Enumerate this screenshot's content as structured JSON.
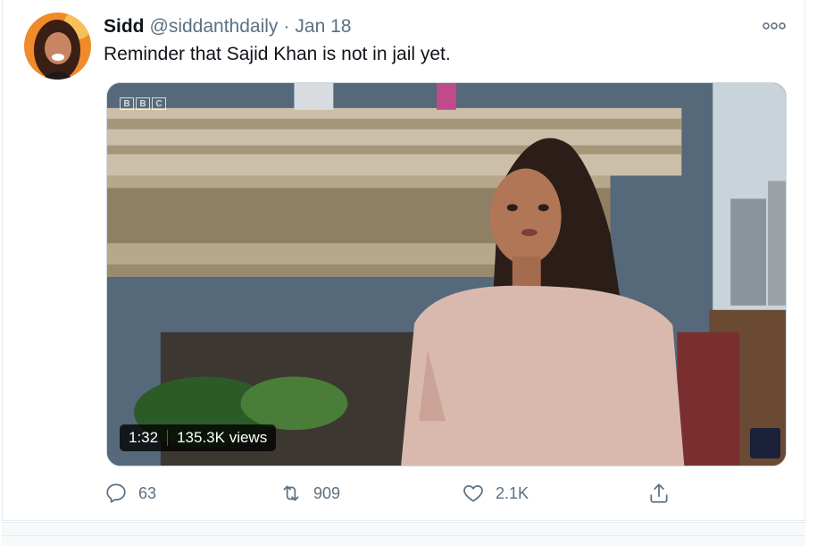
{
  "tweet": {
    "display_name": "Sidd",
    "handle": "@siddanthdaily",
    "separator": "·",
    "date": "Jan 18",
    "text": "Reminder that Sajid Khan is not in jail yet.",
    "avatar_icon": "user-avatar",
    "more_icon": "more-options-icon"
  },
  "media": {
    "channel_logo": [
      "B",
      "B",
      "C"
    ],
    "duration": "1:32",
    "views": "135.3K views"
  },
  "actions": {
    "reply_count": "63",
    "retweet_count": "909",
    "like_count": "2.1K",
    "reply_icon": "reply-icon",
    "retweet_icon": "retweet-icon",
    "like_icon": "heart-icon",
    "share_icon": "share-icon"
  },
  "colors": {
    "secondary_text": "#5b7083",
    "primary_text": "#0f1419",
    "border": "#e6ecf0"
  }
}
